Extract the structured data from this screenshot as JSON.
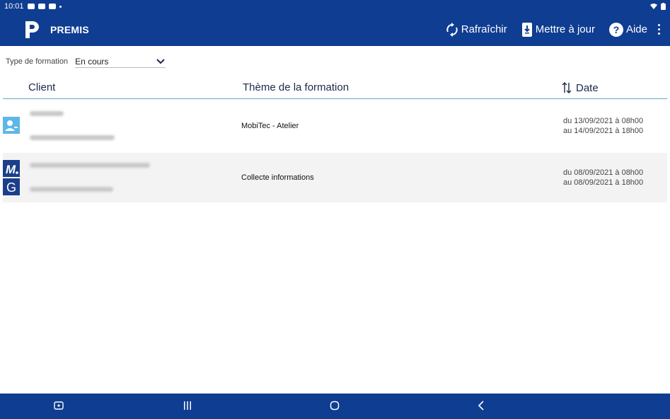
{
  "status": {
    "time": "10:01"
  },
  "app": {
    "title": "PREMIS"
  },
  "actions": {
    "refresh": "Rafraîchir",
    "update": "Mettre à jour",
    "help": "Aide"
  },
  "filter": {
    "label": "Type de formation",
    "value": "En cours"
  },
  "table": {
    "columns": {
      "client": "Client",
      "theme": "Thème de la formation",
      "date": "Date"
    },
    "rows": [
      {
        "theme": "MobiTec - Atelier",
        "date_from": "du 13/09/2021 à 08h00",
        "date_to": "au 14/09/2021 à 18h00"
      },
      {
        "theme": "Collecte informations",
        "date_from": "du 08/09/2021 à 08h00",
        "date_to": "au 08/09/2021 à 18h00"
      }
    ]
  },
  "colors": {
    "brand": "#0f3d91",
    "accent": "#5ea8c9",
    "row_alt": "#f3f3f3"
  },
  "icons": [
    "app-logo-icon",
    "refresh-icon",
    "download-icon",
    "help-icon",
    "more-vert-icon",
    "sort-icon",
    "chevron-down-icon",
    "client-contact-icon",
    "client-logo-m-icon",
    "client-logo-g-icon",
    "nav-recent-icon",
    "nav-home-icon",
    "nav-back-icon",
    "nav-screenshot-icon"
  ]
}
